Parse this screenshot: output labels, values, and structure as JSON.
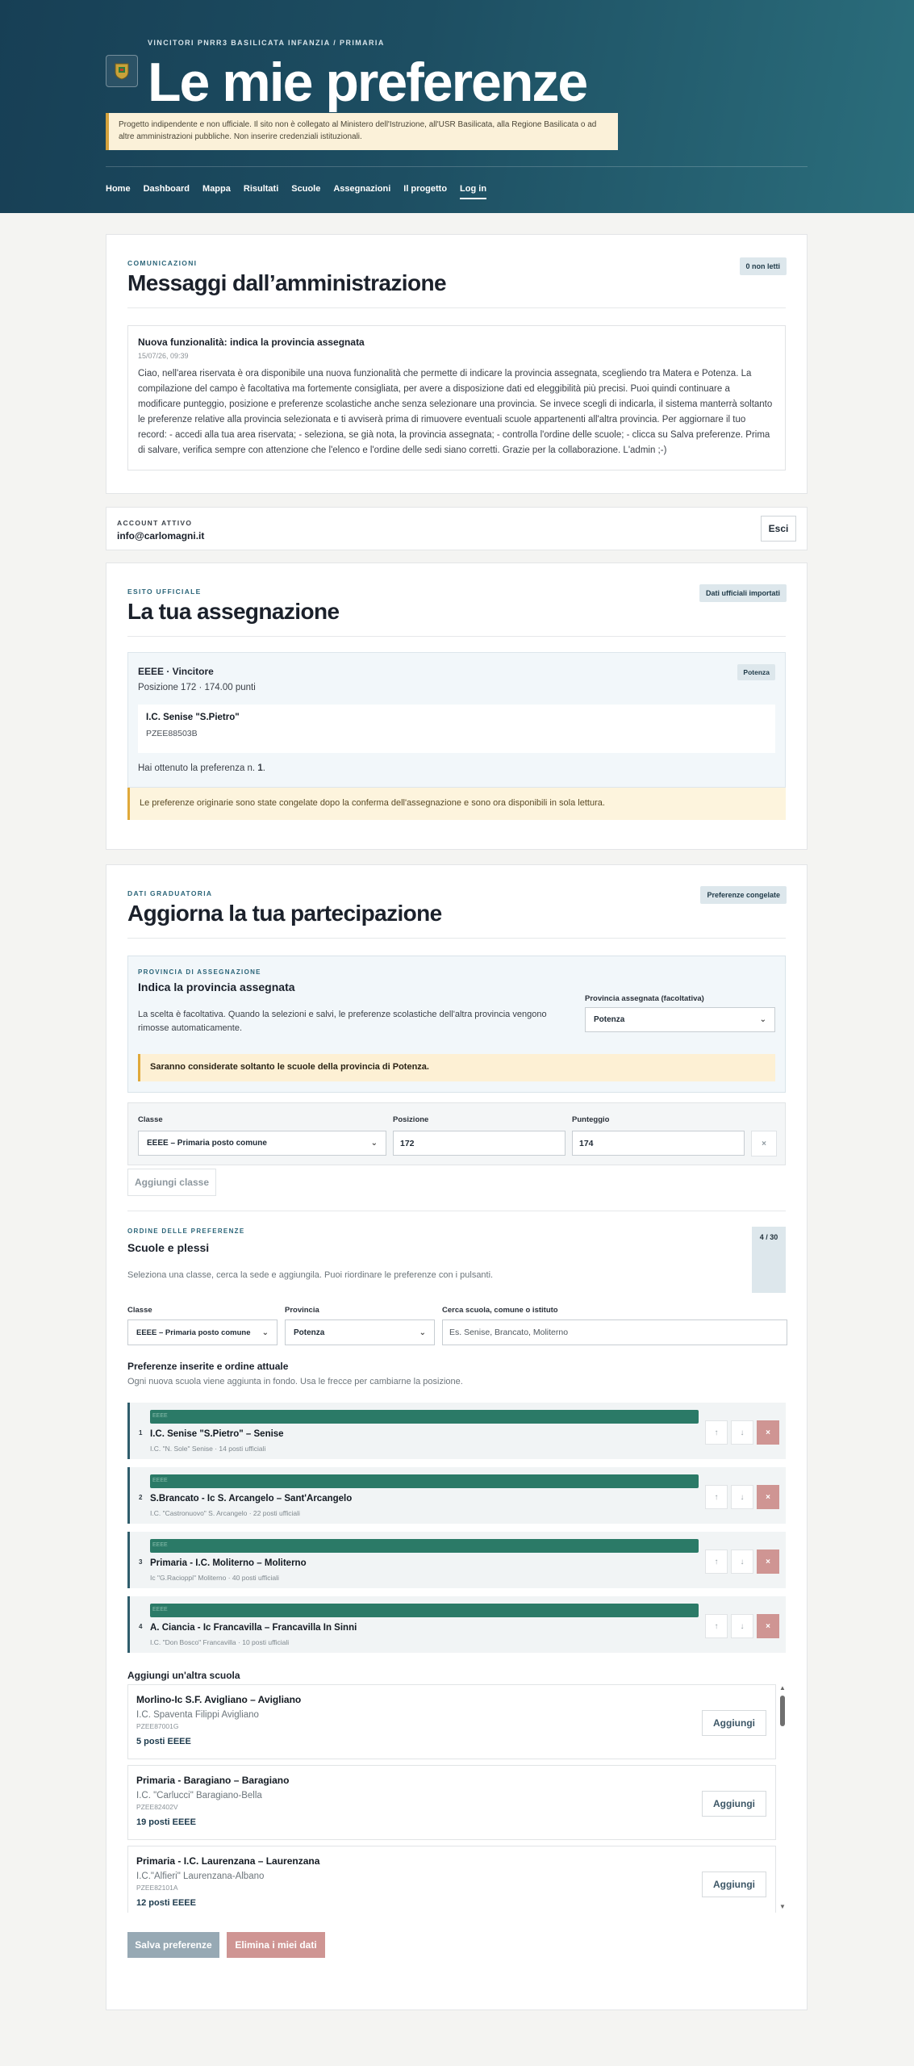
{
  "header": {
    "kicker": "VINCITORI PNRR3 BASILICATA INFANZIA / PRIMARIA",
    "title": "Le mie preferenze",
    "disclaimer": "Progetto indipendente e non ufficiale. Il sito non è collegato al Ministero dell'Istruzione, all'USR Basilicata, alla Regione Basilicata o ad altre amministrazioni pubbliche. Non inserire credenziali istituzionali.",
    "nav": [
      "Home",
      "Dashboard",
      "Mappa",
      "Risultati",
      "Scuole",
      "Assegnazioni",
      "Il progetto",
      "Log in"
    ],
    "logo_icon": "coat-of-arms-icon"
  },
  "messages": {
    "eyebrow": "COMUNICAZIONI",
    "title": "Messaggi dall’amministrazione",
    "badge": "0 non letti",
    "item_title": "Nuova funzionalità: indica la provincia assegnata",
    "item_date": "15/07/26, 09:39",
    "item_body": "Ciao, nell'area riservata è ora disponibile una nuova funzionalità che permette di indicare la provincia assegnata, scegliendo tra Matera e Potenza. La compilazione del campo è facoltativa ma fortemente consigliata, per avere a disposizione dati ed eleggibilità più precisi. Puoi quindi continuare a modificare punteggio, posizione e preferenze scolastiche anche senza selezionare una provincia. Se invece scegli di indicarla, il sistema manterrà soltanto le preferenze relative alla provincia selezionata e ti avviserà prima di rimuovere eventuali scuole appartenenti all'altra provincia. Per aggiornare il tuo record: - accedi alla tua area riservata; - seleziona, se già nota, la provincia assegnata; - controlla l'ordine delle scuole; - clicca su Salva preferenze. Prima di salvare, verifica sempre con attenzione che l'elenco e l'ordine delle sedi siano corretti. Grazie per la collaborazione. L'admin ;-)"
  },
  "account": {
    "label": "ACCOUNT ATTIVO",
    "email": "info@carlomagni.it",
    "logout": "Esci"
  },
  "assignment": {
    "eyebrow": "ESITO UFFICIALE",
    "title": "La tua assegnazione",
    "badge": "Dati ufficiali importati",
    "role": "EEEE · Vincitore",
    "province_badge": "Potenza",
    "position": "Posizione 172 · 174.00 punti",
    "school_name": "I.C. Senise \"S.Pietro\"",
    "school_code": "PZEE88503B",
    "pref_prefix": "Hai ottenuto la preferenza n. ",
    "pref_number": "1",
    "pref_suffix": ".",
    "frozen_note": "Le preferenze originarie sono state congelate dopo la conferma dell'assegnazione e sono ora disponibili in sola lettura."
  },
  "update": {
    "eyebrow": "DATI GRADUATORIA",
    "title": "Aggiorna la tua partecipazione",
    "badge": "Preferenze congelate",
    "province": {
      "eyebrow": "PROVINCIA DI ASSEGNAZIONE",
      "title": "Indica la provincia assegnata",
      "desc": "La scelta è facoltativa. Quando la selezioni e salvi, le preferenze scolastiche dell'altra provincia vengono rimosse automaticamente.",
      "select_label": "Provincia assegnata (facoltativa)",
      "select_value": "Potenza",
      "warning": "Saranno considerate soltanto le scuole della provincia di Potenza."
    },
    "class_row": {
      "class_label": "Classe",
      "class_value": "EEEE – Primaria posto comune",
      "position_label": "Posizione",
      "position_value": "172",
      "score_label": "Punteggio",
      "score_value": "174",
      "remove": "×"
    },
    "add_class": "Aggiungi classe",
    "order": {
      "eyebrow": "ORDINE DELLE PREFERENZE",
      "title": "Scuole e plessi",
      "count": "4 / 30",
      "desc": "Seleziona una classe, cerca la sede e aggiungila. Puoi riordinare le preferenze con i pulsanti.",
      "filter_class_label": "Classe",
      "filter_class_value": "EEEE – Primaria posto comune",
      "filter_province_label": "Provincia",
      "filter_province_value": "Potenza",
      "search_label": "Cerca scuola, comune o istituto",
      "search_placeholder": "Es. Senise, Brancato, Moliterno",
      "list_title": "Preferenze inserite e ordine attuale",
      "list_desc": "Ogni nuova scuola viene aggiunta in fondo. Usa le frecce per cambiarne la posizione."
    },
    "preferences": [
      {
        "num": "1",
        "tag": "EEEE",
        "name": "I.C. Senise \"S.Pietro\" – Senise",
        "sub": "I.C. \"N. Sole\" Senise · 14 posti ufficiali"
      },
      {
        "num": "2",
        "tag": "EEEE",
        "name": "S.Brancato - Ic S. Arcangelo – Sant'Arcangelo",
        "sub": "I.C. \"Castronuovo\" S. Arcangelo · 22 posti ufficiali"
      },
      {
        "num": "3",
        "tag": "EEEE",
        "name": "Primaria - I.C. Moliterno – Moliterno",
        "sub": "Ic \"G.Racioppi\" Moliterno · 40 posti ufficiali"
      },
      {
        "num": "4",
        "tag": "EEEE",
        "name": "A. Ciancia - Ic Francavilla – Francavilla In Sinni",
        "sub": "I.C. \"Don Bosco\" Francavilla · 10 posti ufficiali"
      }
    ],
    "arrows": {
      "up": "↑",
      "down": "↓",
      "delete": "×"
    },
    "add_title": "Aggiungi un'altra scuola",
    "schools": [
      {
        "name": "Morlino-Ic S.F. Avigliano – Avigliano",
        "institute": "I.C. Spaventa Filippi Avigliano",
        "code": "PZEE87001G",
        "posts": "5 posti EEEE"
      },
      {
        "name": "Primaria - Baragiano – Baragiano",
        "institute": "I.C. \"Carlucci\" Baragiano-Bella",
        "code": "PZEE82402V",
        "posts": "19 posti EEEE"
      },
      {
        "name": "Primaria - I.C. Laurenzana – Laurenzana",
        "institute": "I.C.\"Alfieri\" Laurenzana-Albano",
        "code": "PZEE82101A",
        "posts": "12 posti EEEE"
      }
    ],
    "add_button": "Aggiungi",
    "save": "Salva preferenze",
    "delete_data": "Elimina i miei dati"
  },
  "colors": {
    "header_start": "#173f55",
    "header_end": "#2b6e7c",
    "accent_green": "#2b7a67",
    "warning": "#e0a93a",
    "delete": "#cf9593",
    "save": "#97a9b4"
  }
}
